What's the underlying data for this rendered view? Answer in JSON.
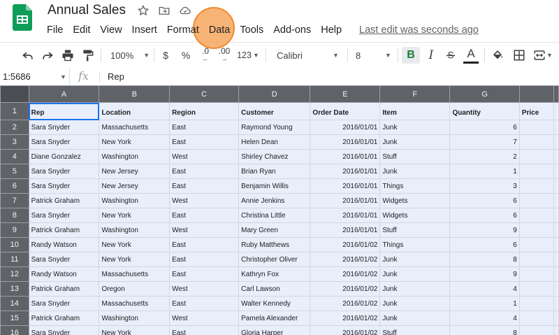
{
  "app": {
    "doc_title": "Annual Sales",
    "last_edit": "Last edit was seconds ago",
    "brand_color": "#0f9d58",
    "accent_color": "#1a73e8"
  },
  "menu": [
    "File",
    "Edit",
    "View",
    "Insert",
    "Format",
    "Data",
    "Tools",
    "Add-ons",
    "Help"
  ],
  "toolbar": {
    "zoom": "100%",
    "currency_label": "$",
    "percent_label": "%",
    "decimal_decrease": ".0",
    "decimal_increase": ".00",
    "more_formats": "123",
    "font": "Calibri",
    "font_size": "8",
    "bold_label": "B",
    "italic_label": "I",
    "text_color_label": "A",
    "icons": [
      "undo-icon",
      "redo-icon",
      "print-icon",
      "paint-format-icon",
      "bold-icon",
      "italic-icon",
      "strikethrough-icon",
      "text-color-icon",
      "fill-color-icon",
      "borders-icon",
      "merge-cells-icon"
    ]
  },
  "formula_bar": {
    "name_box": "1:5686",
    "fx_label": "fx",
    "value": "Rep"
  },
  "sheet": {
    "columns": [
      "A",
      "B",
      "C",
      "D",
      "E",
      "F",
      "G",
      ""
    ],
    "rows": [
      {
        "n": "1",
        "cells": [
          "Rep",
          "Location",
          "Region",
          "Customer",
          "Order Date",
          "Item",
          "Quantity",
          "Price"
        ]
      },
      {
        "n": "2",
        "cells": [
          "Sara Snyder",
          "Massachusetts",
          "East",
          "Raymond Young",
          "2016/01/01",
          "Junk",
          "6",
          ""
        ]
      },
      {
        "n": "3",
        "cells": [
          "Sara Snyder",
          "New York",
          "East",
          "Helen Dean",
          "2016/01/01",
          "Junk",
          "7",
          ""
        ]
      },
      {
        "n": "4",
        "cells": [
          "Diane Gonzalez",
          "Washington",
          "West",
          "Shirley Chavez",
          "2016/01/01",
          "Stuff",
          "2",
          ""
        ]
      },
      {
        "n": "5",
        "cells": [
          "Sara Snyder",
          "New Jersey",
          "East",
          "Brian Ryan",
          "2016/01/01",
          "Junk",
          "1",
          ""
        ]
      },
      {
        "n": "6",
        "cells": [
          "Sara Snyder",
          "New Jersey",
          "East",
          "Benjamin Willis",
          "2016/01/01",
          "Things",
          "3",
          ""
        ]
      },
      {
        "n": "7",
        "cells": [
          "Patrick Graham",
          "Washington",
          "West",
          "Annie Jenkins",
          "2016/01/01",
          "Widgets",
          "6",
          ""
        ]
      },
      {
        "n": "8",
        "cells": [
          "Sara Snyder",
          "New York",
          "East",
          "Christina Little",
          "2016/01/01",
          "Widgets",
          "6",
          ""
        ]
      },
      {
        "n": "9",
        "cells": [
          "Patrick Graham",
          "Washington",
          "West",
          "Mary Green",
          "2016/01/01",
          "Stuff",
          "9",
          ""
        ]
      },
      {
        "n": "10",
        "cells": [
          "Randy Watson",
          "New York",
          "East",
          "Ruby Matthews",
          "2016/01/02",
          "Things",
          "6",
          ""
        ]
      },
      {
        "n": "11",
        "cells": [
          "Sara Snyder",
          "New York",
          "East",
          "Christopher Oliver",
          "2016/01/02",
          "Junk",
          "8",
          ""
        ]
      },
      {
        "n": "12",
        "cells": [
          "Randy Watson",
          "Massachusetts",
          "East",
          "Kathryn Fox",
          "2016/01/02",
          "Junk",
          "9",
          ""
        ]
      },
      {
        "n": "13",
        "cells": [
          "Patrick Graham",
          "Oregon",
          "West",
          "Carl Lawson",
          "2016/01/02",
          "Junk",
          "4",
          ""
        ]
      },
      {
        "n": "14",
        "cells": [
          "Sara Snyder",
          "Massachusetts",
          "East",
          "Walter Kennedy",
          "2016/01/02",
          "Junk",
          "1",
          ""
        ]
      },
      {
        "n": "15",
        "cells": [
          "Patrick Graham",
          "Washington",
          "West",
          "Pamela Alexander",
          "2016/01/02",
          "Junk",
          "4",
          ""
        ]
      },
      {
        "n": "16",
        "cells": [
          "Sara Snyder",
          "New York",
          "East",
          "Gloria Harper",
          "2016/01/02",
          "Stuff",
          "8",
          ""
        ]
      }
    ]
  }
}
